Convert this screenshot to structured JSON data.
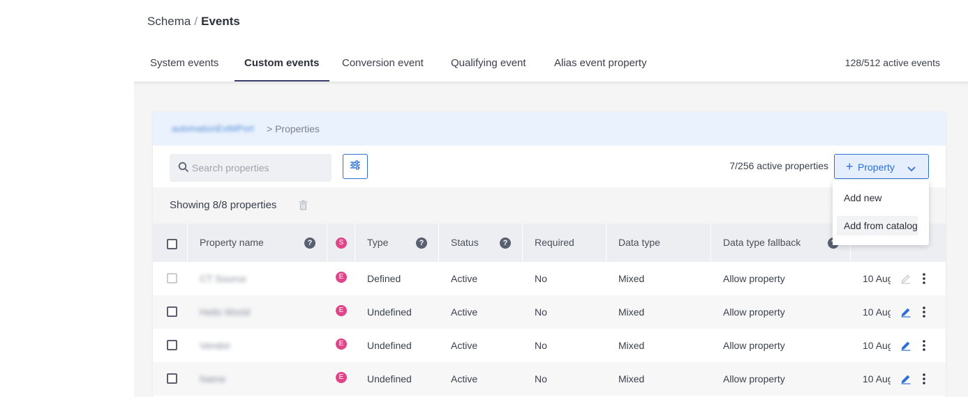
{
  "breadcrumb": {
    "root": "Schema",
    "separator": "/",
    "current": "Events"
  },
  "tabs": [
    {
      "label": "System events"
    },
    {
      "label": "Custom events"
    },
    {
      "label": "Conversion event"
    },
    {
      "label": "Qualifying event"
    },
    {
      "label": "Alias event property"
    }
  ],
  "active_tab": "Custom events",
  "active_events": "128/512 active events",
  "card": {
    "event_name": "automationEvtMPort",
    "properties_crumb": "> Properties"
  },
  "search": {
    "placeholder": "Search properties",
    "value": ""
  },
  "active_properties": "7/256 active properties",
  "property_button": {
    "plus": "+",
    "label": "Property"
  },
  "showing": "Showing 8/8 properties",
  "table": {
    "columns": {
      "name": "Property name",
      "source_badge": "S",
      "type": "Type",
      "status": "Status",
      "required": "Required",
      "data_type": "Data type",
      "fallback": "Data type fallback"
    },
    "help_glyph": "?",
    "rows": [
      {
        "name": "CT Source",
        "badge": "E",
        "type": "Defined",
        "status": "Active",
        "required": "No",
        "data_type": "Mixed",
        "fallback": "Allow property",
        "date": "10 Aug"
      },
      {
        "name": "Hello World",
        "badge": "E",
        "type": "Undefined",
        "status": "Active",
        "required": "No",
        "data_type": "Mixed",
        "fallback": "Allow property",
        "date": "10 Aug"
      },
      {
        "name": "Vendor",
        "badge": "E",
        "type": "Undefined",
        "status": "Active",
        "required": "No",
        "data_type": "Mixed",
        "fallback": "Allow property",
        "date": "10 Aug"
      },
      {
        "name": "Name",
        "badge": "E",
        "type": "Undefined",
        "status": "Active",
        "required": "No",
        "data_type": "Mixed",
        "fallback": "Allow property",
        "date": "10 Aug"
      }
    ]
  },
  "dropdown": {
    "items": [
      {
        "label": "Add new"
      },
      {
        "label": "Add from catalog"
      }
    ]
  },
  "colors": {
    "accent": "#2d6fd6",
    "badge": "#e0458a",
    "header_bg": "#e9f2fd",
    "tab_underline": "#3b3d6b"
  },
  "icons": [
    "search-icon",
    "filter-sliders-icon",
    "plus-icon",
    "chevron-down-icon",
    "trash-icon",
    "help-icon",
    "edit-pencil-icon",
    "more-vertical-icon"
  ]
}
